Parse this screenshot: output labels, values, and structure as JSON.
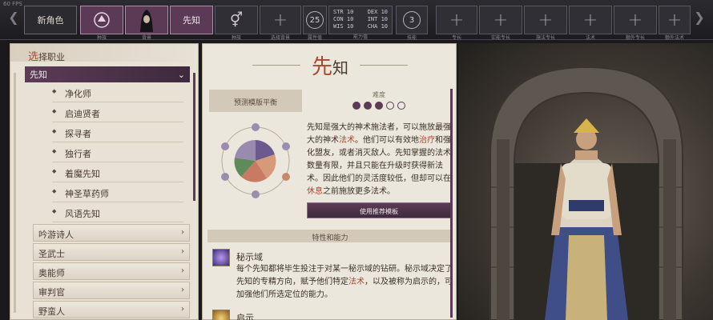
{
  "topbar": {
    "fps": "60 FPS",
    "new_char": "新角色",
    "tiles": [
      {
        "label": "种族",
        "kind": "race"
      },
      {
        "label": "背景",
        "kind": "portrait"
      },
      {
        "label": "",
        "text": "先知",
        "kind": "class"
      },
      {
        "label": "种族",
        "kind": "gender"
      }
    ],
    "plus_labels": [
      "选择背景",
      "",
      "",
      "技能",
      "专长",
      "实能专长",
      "施法专长",
      "法术",
      "额外专长",
      "额外法术"
    ],
    "ring_25": "25",
    "ring_25_label": "属性值",
    "ring_3": "3",
    "ring_3_label": "技能",
    "stats": {
      "STR": "10",
      "DEX": "10",
      "CON": "10",
      "INT": "10",
      "WIS": "10",
      "CHA": "10",
      "label": "能力值"
    }
  },
  "left": {
    "header_first": "选",
    "header_rest": "择职业",
    "selected_class": "先知",
    "subclasses": [
      "净化师",
      "启迪贤者",
      "探寻者",
      "独行者",
      "着魔先知",
      "神圣草药师",
      "风语先知"
    ],
    "classes": [
      "吟游诗人",
      "圣武士",
      "奥能师",
      "审判官",
      "野蛮人"
    ]
  },
  "middle": {
    "title_first": "先",
    "title_rest": "知",
    "preset_header": "预测模版平衡",
    "difficulty_label": "难度",
    "difficulty": 3,
    "difficulty_max": 5,
    "desc_1": "先知是强大的神术施法者，可以施放最强大的神术",
    "desc_hl_1": "法术",
    "desc_2": "。他们可以有效地",
    "desc_hl_2": "治疗",
    "desc_3": "和强化盟友，或者消灭敌人。先知掌握的法术数量有限，并且只能在升级时获得新法术。因此他们的灵活度较低，但却可以在",
    "desc_hl_3": "休息",
    "desc_4": "之前施放更多法术。",
    "use_preset": "使用推荐模板",
    "features_header": "特性和能力",
    "feat1_title": "秘示域",
    "feat1_a": "每个先知都将毕生投注于对某一秘示域的钻研。秘示域决定了先知的专精方向，赋予他们特定",
    "feat1_hl": "法术",
    "feat1_b": "，以及被称为启示的，可加强他们所选定位的能力。",
    "feat2_title": "启示"
  }
}
